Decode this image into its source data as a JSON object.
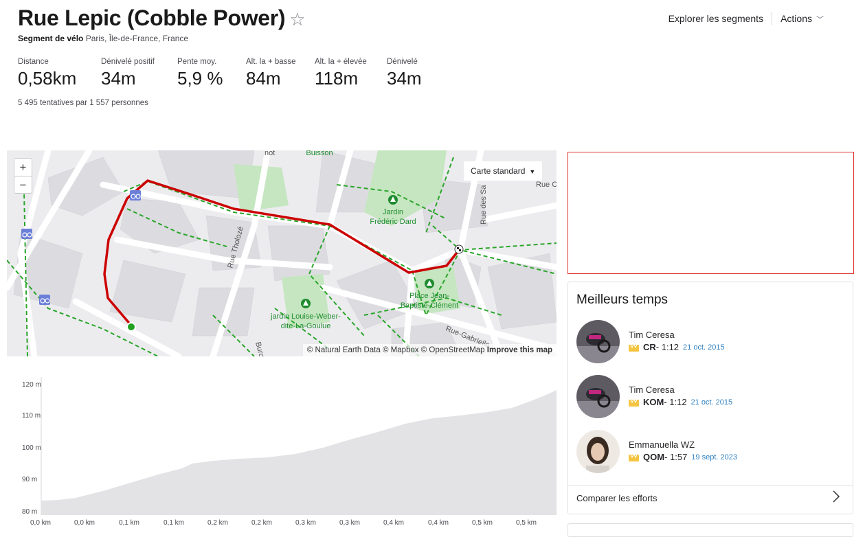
{
  "segment": {
    "title": "Rue Lepic (Cobble Power)",
    "type_label": "Segment de vélo",
    "location": "Paris, Île-de-France, France",
    "attempts": "5 495 tentatives par 1 557 personnes"
  },
  "top_nav": {
    "explore": "Explorer les segments",
    "actions": "Actions"
  },
  "stats": [
    {
      "label": "Distance",
      "value": "0,58km"
    },
    {
      "label": "Dénivelé positif",
      "value": "34m"
    },
    {
      "label": "Pente moy.",
      "value": "5,9 %"
    },
    {
      "label": "Alt. la + basse",
      "value": "84m"
    },
    {
      "label": "Alt. la + élevée",
      "value": "118m"
    },
    {
      "label": "Dénivelé",
      "value": "34m"
    }
  ],
  "map": {
    "zoom_in": "+",
    "zoom_out": "−",
    "map_type": "Carte standard",
    "attribution": "© Natural Earth Data © Mapbox © OpenStreetMap",
    "improve": "Improve this map",
    "labels": {
      "buisson": "Buisson",
      "jardin_dard_1": "Jardin",
      "jardin_dard_2": "Frédéric Dard",
      "place_1": "Place Jean-",
      "place_2": "Baptiste-Clément",
      "jardin_lwg_1": "jardin Louise-Weber-",
      "jardin_lwg_2": "dite-La-Goulue",
      "rue_tholoze": "Rue Tholozé",
      "rue_des_sa": "Rue des Sa",
      "rue_c": "Rue C",
      "rue_gabrielle": "Rue-Gabrielle",
      "burq": "Burq",
      "not": "not"
    },
    "route_color": "#cc0000",
    "path_color": "#2aa52a"
  },
  "elevation": {
    "y_ticks": [
      "120 m",
      "110 m",
      "100 m",
      "90 m",
      "80 m"
    ],
    "x_ticks": [
      "0,0 km",
      "0,0 km",
      "0,1 km",
      "0,1 km",
      "0,2 km",
      "0,2 km",
      "0,3 km",
      "0,3 km",
      "0,4 km",
      "0,4 km",
      "0,5 km",
      "0,5 km"
    ]
  },
  "leaderboard": {
    "title": "Meilleurs temps",
    "entries": [
      {
        "name": "Tim Ceresa",
        "rank": "CR",
        "time": " - 1:12",
        "date": "21 oct. 2015"
      },
      {
        "name": "Tim Ceresa",
        "rank": "KOM",
        "time": " - 1:12",
        "date": "21 oct. 2015"
      },
      {
        "name": "Emmanuella WZ",
        "rank": "QOM",
        "time": " - 1:57",
        "date": "19 sept. 2023"
      }
    ],
    "compare": "Comparer les efforts"
  }
}
